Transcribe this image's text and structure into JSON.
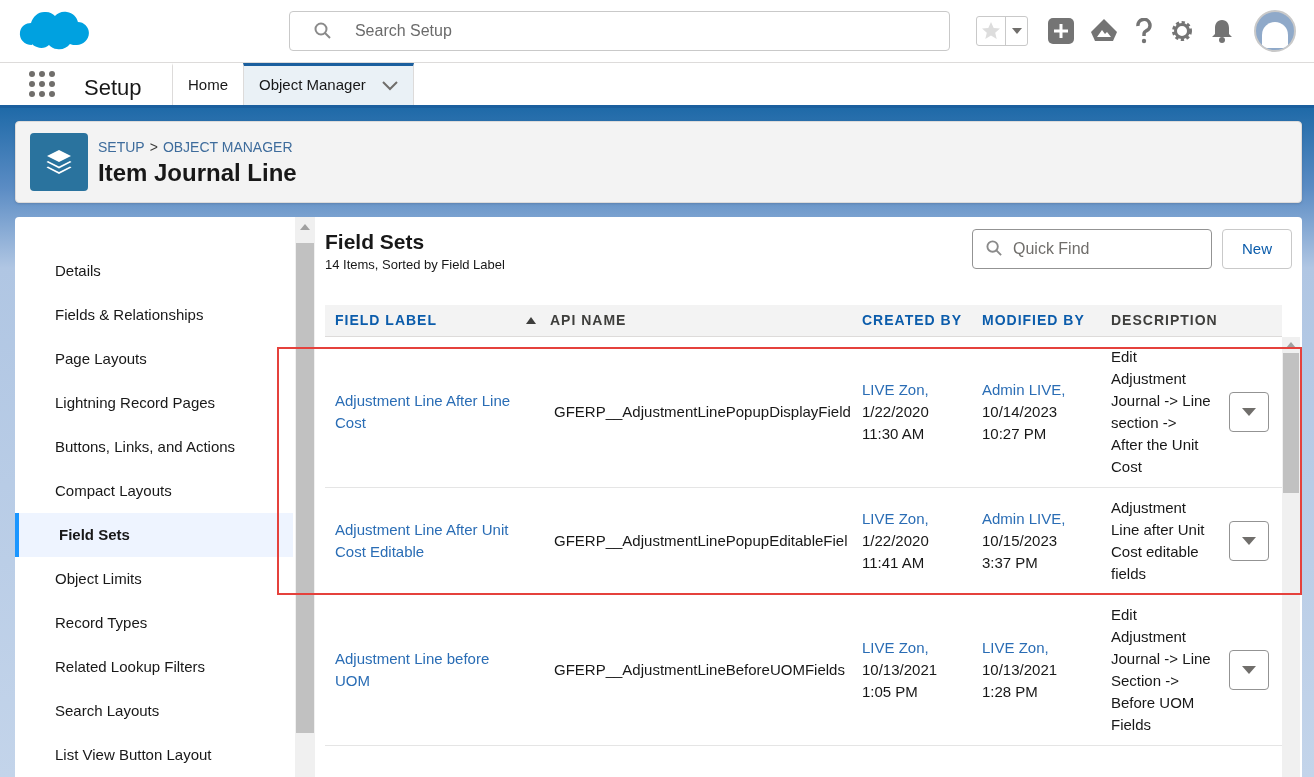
{
  "header": {
    "search": {
      "placeholder": "Search Setup"
    }
  },
  "nav": {
    "app_name": "Setup",
    "tabs": [
      {
        "label": "Home",
        "selected": false,
        "menu": false
      },
      {
        "label": "Object Manager",
        "selected": true,
        "menu": true
      }
    ]
  },
  "page_header": {
    "breadcrumb": [
      "SETUP",
      "OBJECT MANAGER"
    ],
    "separator": ">",
    "title": "Item Journal Line"
  },
  "sidebar": {
    "items": [
      {
        "label": "Details",
        "selected": false
      },
      {
        "label": "Fields & Relationships",
        "selected": false
      },
      {
        "label": "Page Layouts",
        "selected": false
      },
      {
        "label": "Lightning Record Pages",
        "selected": false
      },
      {
        "label": "Buttons, Links, and Actions",
        "selected": false
      },
      {
        "label": "Compact Layouts",
        "selected": false
      },
      {
        "label": "Field Sets",
        "selected": true
      },
      {
        "label": "Object Limits",
        "selected": false
      },
      {
        "label": "Record Types",
        "selected": false
      },
      {
        "label": "Related Lookup Filters",
        "selected": false
      },
      {
        "label": "Search Layouts",
        "selected": false
      },
      {
        "label": "List View Button Layout",
        "selected": false
      }
    ]
  },
  "content": {
    "title": "Field Sets",
    "subtitle": "14 Items, Sorted by Field Label",
    "quick_find": {
      "placeholder": "Quick Find"
    },
    "new_button": "New",
    "table": {
      "columns": [
        {
          "label": "FIELD LABEL",
          "sortable": true,
          "sorted": true
        },
        {
          "label": "API NAME",
          "sortable": false,
          "sorted": false
        },
        {
          "label": "CREATED BY",
          "sortable": true,
          "sorted": false
        },
        {
          "label": "MODIFIED BY",
          "sortable": true,
          "sorted": false
        },
        {
          "label": "DESCRIPTION",
          "sortable": false,
          "sorted": false
        }
      ],
      "rows": [
        {
          "highlighted": true,
          "field_label": "Adjustment Line After Line Cost",
          "api_name": "GFERP__AdjustmentLinePopupDisplayField",
          "created_by": "LIVE Zon,",
          "created_on": [
            "1/22/2020",
            "11:30 AM"
          ],
          "modified_by": "Admin LIVE,",
          "modified_on": [
            "10/14/2023",
            "10:27 PM"
          ],
          "description": "Edit Adjustment Journal -> Line section -> After the Unit Cost"
        },
        {
          "highlighted": true,
          "field_label": "Adjustment Line After Unit Cost Editable",
          "api_name": "GFERP__AdjustmentLinePopupEditableFiel",
          "created_by": "LIVE Zon,",
          "created_on": [
            "1/22/2020",
            "11:41 AM"
          ],
          "modified_by": "Admin LIVE,",
          "modified_on": [
            "10/15/2023",
            "3:37 PM"
          ],
          "description": "Adjustment Line after Unit Cost editable fields"
        },
        {
          "highlighted": false,
          "field_label": "Adjustment Line before UOM",
          "api_name": "GFERP__AdjustmentLineBeforeUOMFields",
          "created_by": "LIVE Zon,",
          "created_on": [
            "10/13/2021",
            "1:05 PM"
          ],
          "modified_by": "LIVE Zon,",
          "modified_on": [
            "10/13/2021",
            "1:28 PM"
          ],
          "description": "Edit Adjustment Journal -> Line Section -> Before UOM Fields"
        }
      ]
    }
  }
}
